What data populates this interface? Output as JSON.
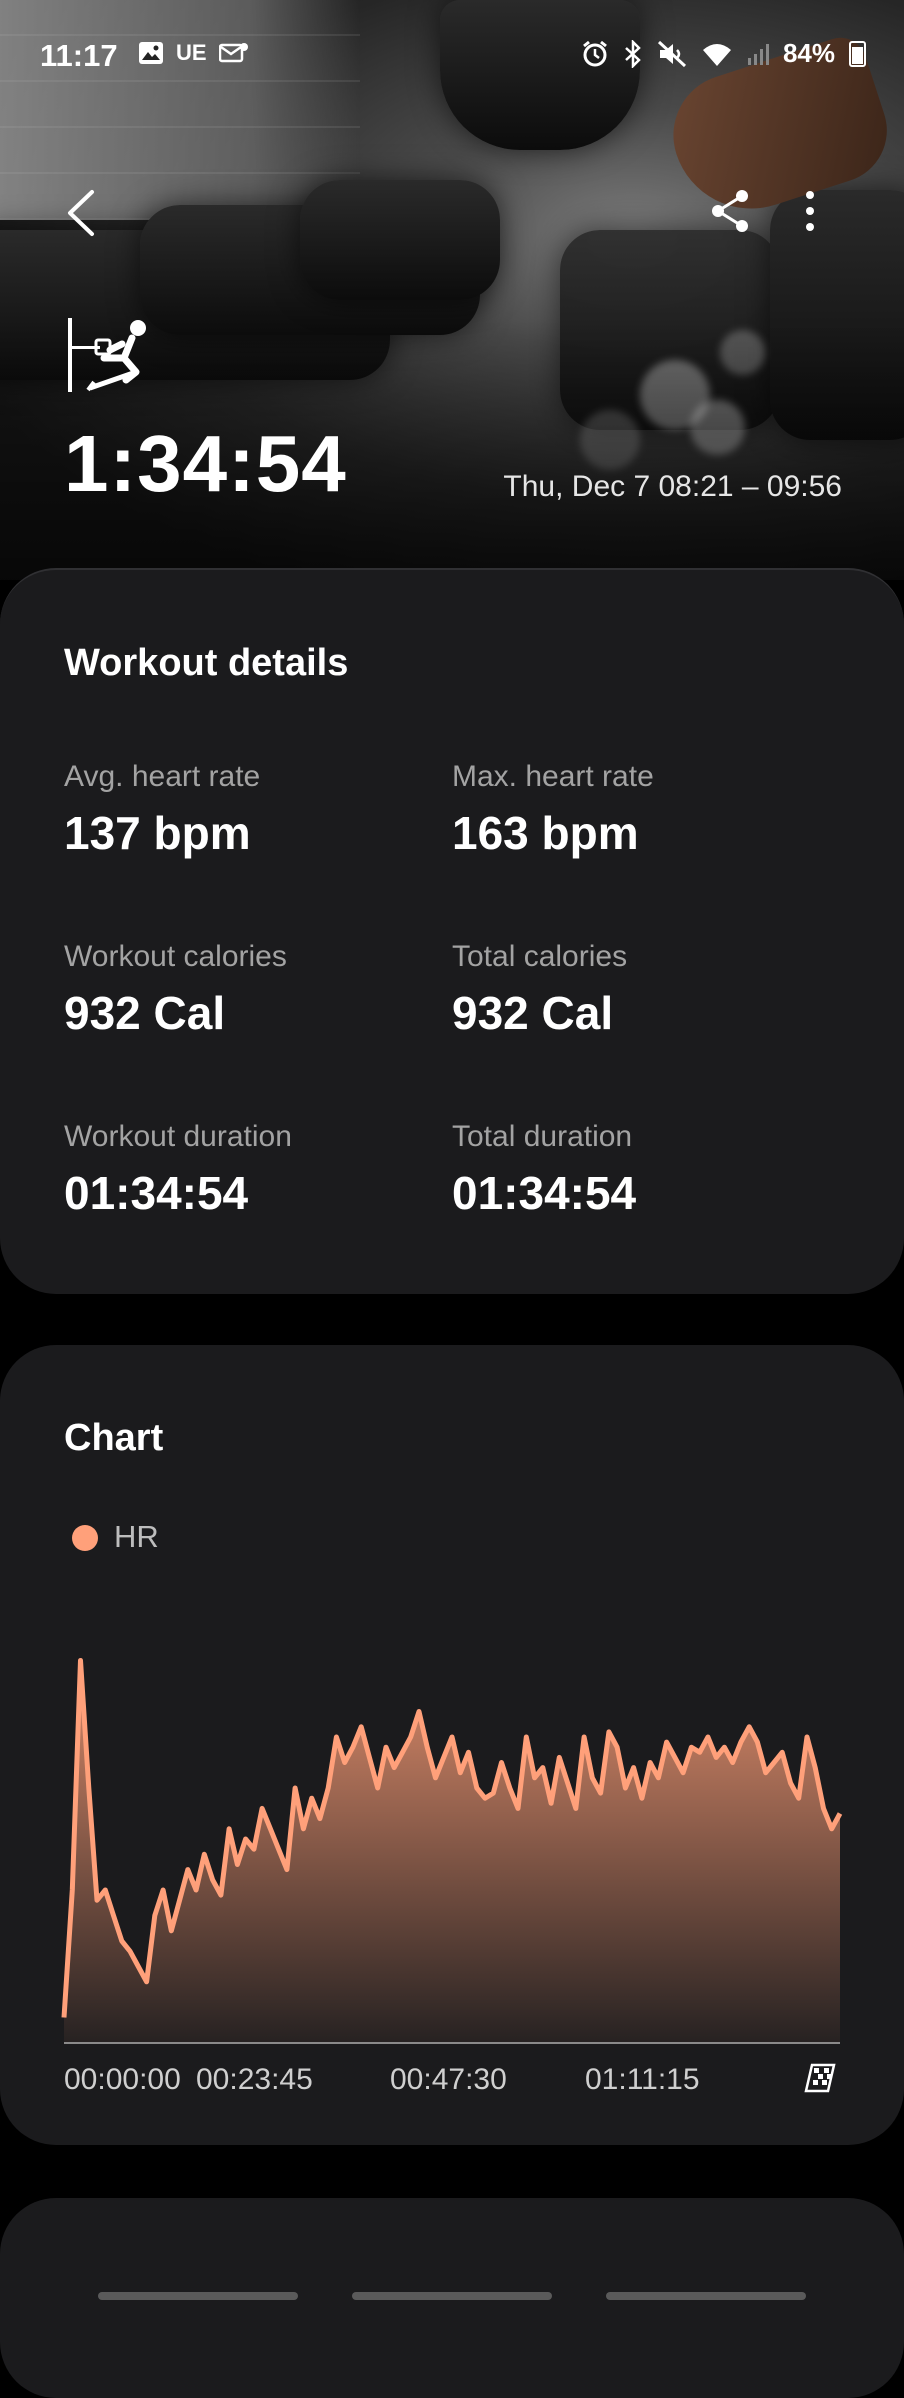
{
  "status_bar": {
    "time": "11:17",
    "left_icons": [
      "gallery-icon",
      "UE",
      "message-icon"
    ],
    "right_icons": [
      "alarm-icon",
      "bluetooth-icon",
      "mute-icon",
      "wifi-icon",
      "signal-icon"
    ],
    "battery": "84%"
  },
  "header": {
    "duration": "1:34:54",
    "date_range": "Thu, Dec 7 08:21 – 09:56"
  },
  "details": {
    "title": "Workout details",
    "metrics": [
      {
        "label": "Avg. heart rate",
        "value": "137 bpm"
      },
      {
        "label": "Max. heart rate",
        "value": "163 bpm"
      },
      {
        "label": "Workout calories",
        "value": "932 Cal"
      },
      {
        "label": "Total calories",
        "value": "932 Cal"
      },
      {
        "label": "Workout duration",
        "value": "01:34:54"
      },
      {
        "label": "Total duration",
        "value": "01:34:54"
      }
    ]
  },
  "chart": {
    "title": "Chart",
    "legend": "HR",
    "x_ticks": [
      "00:00:00",
      "00:23:45",
      "00:47:30",
      "01:11:15"
    ]
  },
  "chart_data": {
    "type": "area",
    "title": "Chart",
    "series": [
      {
        "name": "HR",
        "color": "#ffa07a",
        "values": [
          95,
          120,
          165,
          140,
          118,
          120,
          115,
          110,
          108,
          105,
          102,
          115,
          120,
          112,
          118,
          124,
          120,
          127,
          122,
          119,
          132,
          125,
          130,
          128,
          136,
          132,
          128,
          124,
          140,
          132,
          138,
          134,
          140,
          150,
          145,
          148,
          152,
          146,
          140,
          148,
          144,
          147,
          150,
          155,
          148,
          142,
          146,
          150,
          143,
          147,
          140,
          138,
          139,
          145,
          140,
          136,
          150,
          142,
          144,
          137,
          146,
          141,
          136,
          150,
          142,
          139,
          151,
          148,
          140,
          144,
          138,
          145,
          142,
          149,
          146,
          143,
          148,
          147,
          150,
          146,
          148,
          145,
          149,
          152,
          149,
          143,
          145,
          147,
          141,
          138,
          150,
          144,
          136,
          132,
          135
        ]
      }
    ],
    "x_ticks": [
      "00:00:00",
      "00:23:45",
      "00:47:30",
      "01:11:15"
    ],
    "y_range": [
      90,
      170
    ]
  }
}
